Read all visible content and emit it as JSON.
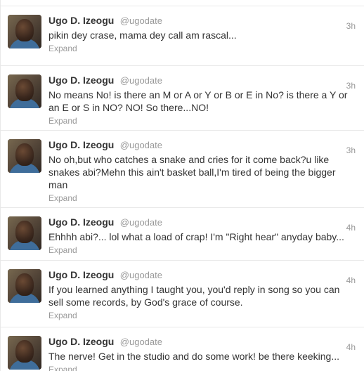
{
  "tweets": [
    {
      "name": "Ugo D. Izeogu",
      "handle": "@ugodate",
      "time": "3h",
      "text": "pikin dey crase, mama dey call am rascal...",
      "action": "Expand"
    },
    {
      "name": "Ugo D. Izeogu",
      "handle": "@ugodate",
      "time": "3h",
      "text": "No means No! is there an M or A or Y or B or E in No? is there a Y or an E or S in NO? NO! So there...NO!",
      "action": "Expand"
    },
    {
      "name": "Ugo D. Izeogu",
      "handle": "@ugodate",
      "time": "3h",
      "text": "No oh,but who catches a snake and cries for it come back?u like snakes abi?Mehn this ain't basket ball,I'm tired of being the bigger man",
      "action": "Expand"
    },
    {
      "name": "Ugo D. Izeogu",
      "handle": "@ugodate",
      "time": "4h",
      "text": "Ehhhh abi?... lol what a load of crap! I'm \"Right hear\" anyday baby...",
      "action": "Expand"
    },
    {
      "name": "Ugo D. Izeogu",
      "handle": "@ugodate",
      "time": "4h",
      "text": "If you learned anything I taught you, you'd reply in song so you can sell some records, by God's grace of course.",
      "action": "Expand"
    },
    {
      "name": "Ugo D. Izeogu",
      "handle": "@ugodate",
      "time": "4h",
      "text": "The nerve! Get in the studio and do some work! be there keeking...",
      "action": "Expand"
    }
  ],
  "colors": {
    "text": "#333333",
    "muted": "#999999",
    "divider": "#e8e8e8",
    "background": "#ffffff"
  },
  "icons": {
    "avatar": "profile-photo"
  }
}
